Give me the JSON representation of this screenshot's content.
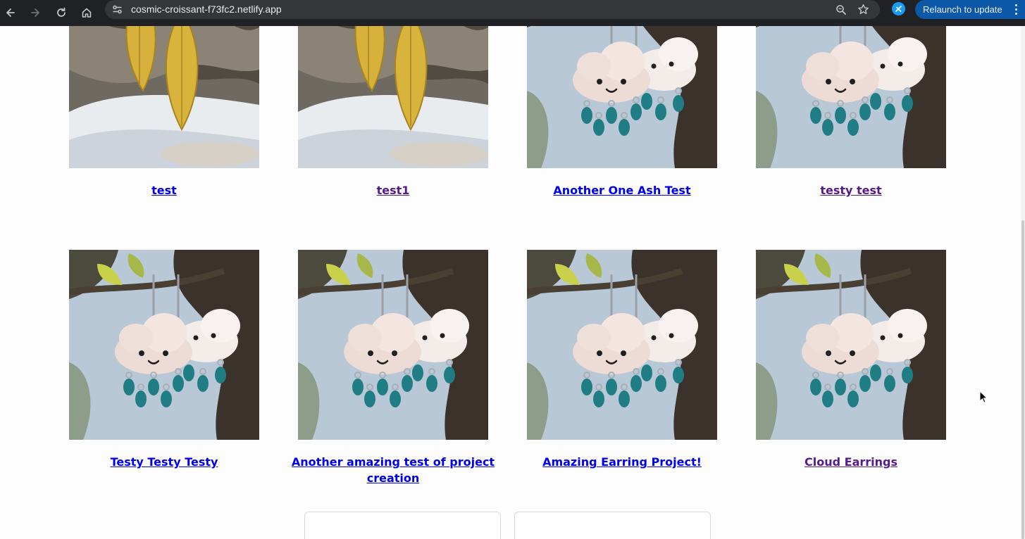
{
  "browser": {
    "url": "cosmic-croissant-f73fc2.netlify.app",
    "relaunch_label": "Relaunch to update"
  },
  "colors": {
    "link": "#0000ee",
    "visited_link": "#551a8b",
    "chrome_bg": "#202124",
    "relaunch_bg": "#0b57a8"
  },
  "projects": [
    {
      "title": "test",
      "image": "gold-leaf-earrings",
      "visited": false
    },
    {
      "title": "test1",
      "image": "gold-leaf-earrings",
      "visited": true
    },
    {
      "title": "Another One Ash Test",
      "image": "cloud-earrings",
      "visited": false
    },
    {
      "title": "testy test",
      "image": "cloud-earrings",
      "visited": true
    },
    {
      "title": "Testy Testy Testy",
      "image": "cloud-earrings",
      "visited": false
    },
    {
      "title": "Another amazing test of project creation",
      "image": "cloud-earrings",
      "visited": false
    },
    {
      "title": "Amazing Earring Project!",
      "image": "cloud-earrings",
      "visited": false
    },
    {
      "title": "Cloud Earrings",
      "image": "cloud-earrings",
      "visited": true
    }
  ]
}
